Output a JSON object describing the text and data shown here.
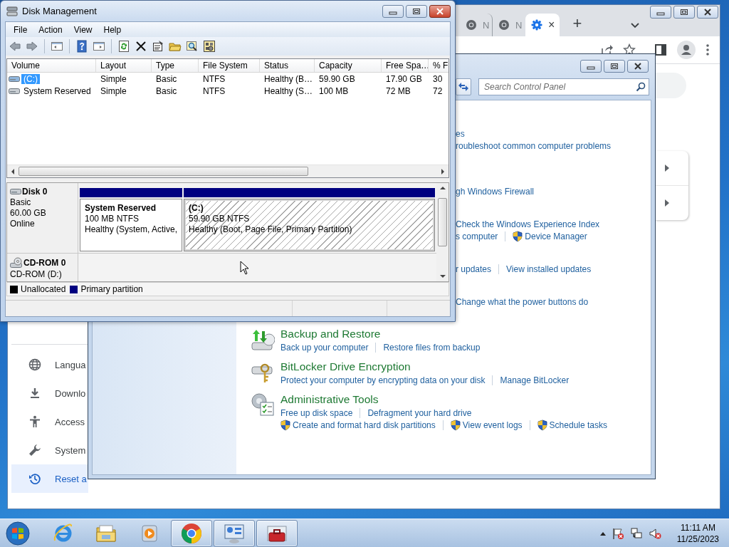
{
  "disk_management": {
    "title": "Disk Management",
    "menu": [
      "File",
      "Action",
      "View",
      "Help"
    ],
    "volumes": {
      "columns": [
        "Volume",
        "Layout",
        "Type",
        "File System",
        "Status",
        "Capacity",
        "Free Spa…",
        "% F"
      ],
      "rows": [
        {
          "selected": true,
          "cells": [
            "(C:)",
            "Simple",
            "Basic",
            "NTFS",
            "Healthy (B…",
            "59.90 GB",
            "17.90 GB",
            "30"
          ]
        },
        {
          "selected": false,
          "cells": [
            "System Reserved",
            "Simple",
            "Basic",
            "NTFS",
            "Healthy (S…",
            "100 MB",
            "72 MB",
            "72"
          ]
        }
      ]
    },
    "disks": [
      {
        "kind": "disk",
        "name": "Disk 0",
        "details": [
          "Basic",
          "60.00 GB",
          "Online"
        ],
        "partitions": [
          {
            "name": "System Reserved",
            "lines": [
              "100 MB NTFS",
              "Healthy (System, Active,"
            ],
            "selected": false
          },
          {
            "name": "(C:)",
            "lines": [
              "59.90 GB NTFS",
              "Healthy (Boot, Page File, Primary Partition)"
            ],
            "selected": true
          }
        ]
      },
      {
        "kind": "cdrom",
        "name": "CD-ROM 0",
        "details": [
          "CD-ROM (D:)"
        ]
      }
    ],
    "legend": [
      {
        "label": "Unallocated",
        "color": "#000000"
      },
      {
        "label": "Primary partition",
        "color": "#000080"
      }
    ]
  },
  "browser": {
    "tabs": [
      {
        "kind": "site",
        "label": "N",
        "selected": false
      },
      {
        "kind": "site",
        "label": "N",
        "selected": false
      },
      {
        "kind": "settings",
        "close": "×",
        "selected": true
      }
    ],
    "new_tab": "+",
    "sidebar": [
      {
        "label": "Langua",
        "selected": false
      },
      {
        "label": "Downlo",
        "selected": false
      },
      {
        "label": "Access",
        "selected": false
      },
      {
        "label": "System",
        "selected": false
      },
      {
        "label": "Reset a",
        "selected": true
      }
    ]
  },
  "control_panel": {
    "search": {
      "placeholder": "Search Control Panel"
    },
    "categories": [
      {
        "kind": "cut",
        "links": [
          [
            {
              "text": "es",
              "shield": false
            }
          ],
          [
            {
              "text": "roubleshoot common computer problems",
              "shield": false
            }
          ]
        ]
      },
      {
        "kind": "cut",
        "links": [
          [
            {
              "text": "gh Windows Firewall",
              "shield": false
            }
          ]
        ]
      },
      {
        "kind": "cut",
        "links": [
          [
            {
              "text": "Check the Windows Experience Index",
              "shield": false
            }
          ],
          [
            {
              "text": "s computer",
              "shield": false
            },
            {
              "text": "Device Manager",
              "shield": true
            }
          ]
        ]
      },
      {
        "kind": "cut",
        "links": [
          [
            {
              "text": "r updates",
              "shield": false
            },
            {
              "text": "View installed updates",
              "shield": false
            }
          ]
        ]
      },
      {
        "kind": "cut",
        "links": [
          [
            {
              "text": "Change what the power buttons do",
              "shield": false
            }
          ]
        ]
      },
      {
        "kind": "backup",
        "title": "Backup and Restore",
        "links": [
          [
            {
              "text": "Back up your computer",
              "shield": false
            },
            {
              "text": "Restore files from backup",
              "shield": false
            }
          ]
        ]
      },
      {
        "kind": "bitlocker",
        "title": "BitLocker Drive Encryption",
        "links": [
          [
            {
              "text": "Protect your computer by encrypting data on your disk",
              "shield": false
            },
            {
              "text": "Manage BitLocker",
              "shield": false
            }
          ]
        ]
      },
      {
        "kind": "tools",
        "title": "Administrative Tools",
        "links": [
          [
            {
              "text": "Free up disk space",
              "shield": false
            },
            {
              "text": "Defragment your hard drive",
              "shield": false
            }
          ],
          [
            {
              "text": "Create and format hard disk partitions",
              "shield": true
            },
            {
              "text": "View event logs",
              "shield": true
            },
            {
              "text": "Schedule tasks",
              "shield": true
            }
          ]
        ]
      }
    ]
  },
  "taskbar": {
    "apps": [
      {
        "kind": "ie",
        "running": false
      },
      {
        "kind": "explorer",
        "running": false
      },
      {
        "kind": "media",
        "running": false
      },
      {
        "kind": "chrome",
        "running": true
      },
      {
        "kind": "control_panel",
        "running": true
      },
      {
        "kind": "toolbox",
        "running": true
      }
    ],
    "clock": {
      "time": "11:11 AM",
      "date": "11/25/2023"
    }
  }
}
